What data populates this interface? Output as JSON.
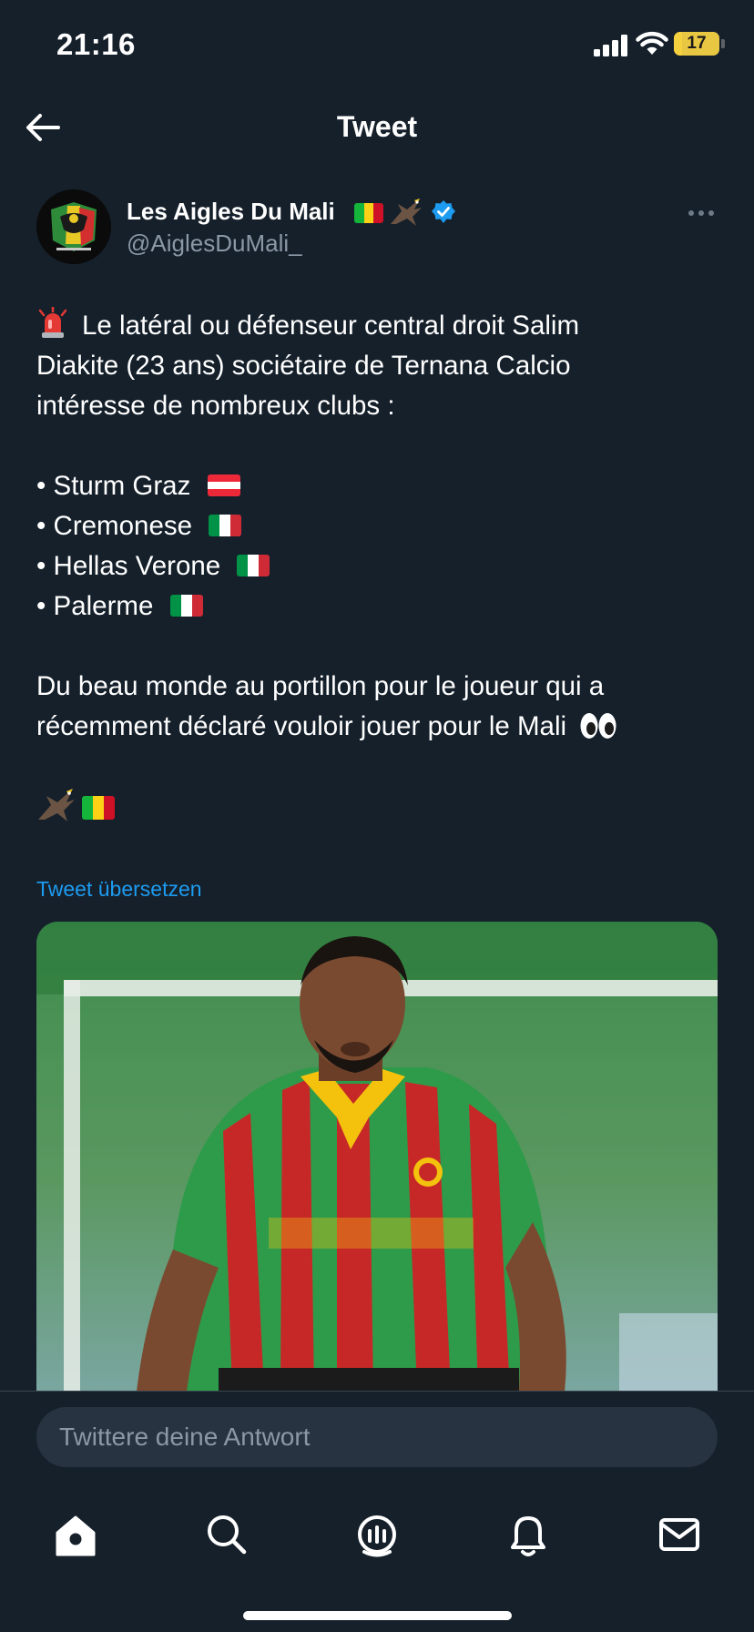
{
  "status_bar": {
    "time": "21:16",
    "battery": "17"
  },
  "header": {
    "title": "Tweet"
  },
  "author": {
    "name": "Les Aigles Du Mali",
    "handle": "@AiglesDuMali_"
  },
  "tweet": {
    "line1": "Le latéral ou défenseur central droit Salim",
    "line2": "Diakite (23 ans) sociétaire de Ternana Calcio",
    "line3": "intéresse de nombreux clubs :",
    "clubs": [
      "• Sturm Graz",
      "• Cremonese",
      "• Hellas Verone",
      "• Palerme"
    ],
    "line4": "Du beau monde au portillon pour le joueur qui a",
    "line5": "récemment déclaré vouloir jouer pour le Mali"
  },
  "translate_label": "Tweet übersetzen",
  "reply": {
    "placeholder": "Twittere deine Antwort"
  },
  "colors": {
    "background": "#15202b",
    "accent": "#1d9bf0",
    "muted": "#8b98a5",
    "divider": "#38444d"
  },
  "icons": {
    "header": [
      "back-arrow-icon"
    ],
    "author": [
      "mali-flag-icon",
      "eagle-icon",
      "verified-badge-icon",
      "more-icon"
    ],
    "tabs": [
      "home-icon",
      "search-icon",
      "spaces-icon",
      "notifications-icon",
      "messages-icon"
    ]
  }
}
